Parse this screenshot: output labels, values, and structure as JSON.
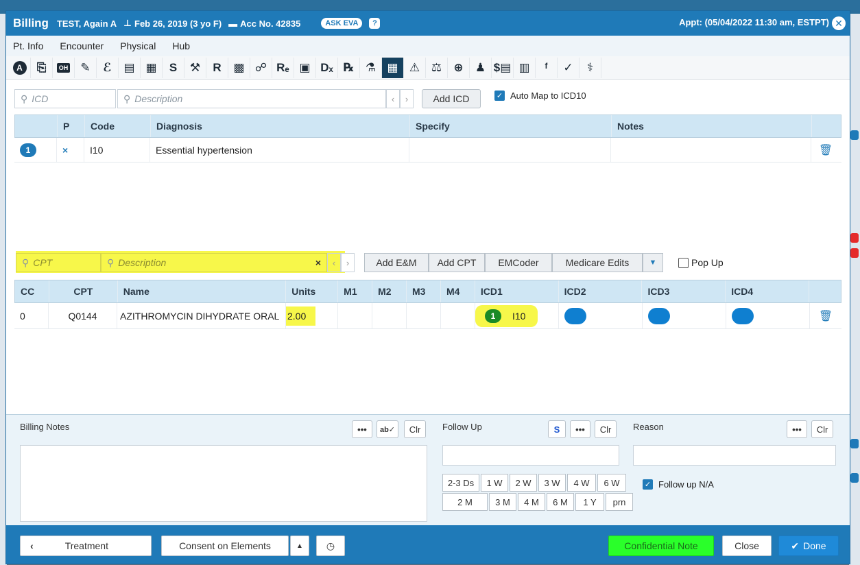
{
  "window": {
    "title": "Billing",
    "patient": "TEST, Again A",
    "dob": "Feb 26, 2019 (3 yo F)",
    "account": "Acc No. 42835",
    "ask_eva": "ASK EVA",
    "help": "?",
    "appointment": "Appt: (05/04/2022 11:30 am, ESTPT)"
  },
  "menu": [
    "Pt. Info",
    "Encounter",
    "Physical",
    "Hub"
  ],
  "toolbar": [
    "A",
    "⎘",
    "OH",
    "✎",
    "ℰ",
    "▤",
    "▦",
    "S",
    "⚒",
    "R",
    "▩",
    "☍",
    "Rₑ",
    "▣",
    "Dₓ",
    "℞",
    "⚗",
    "▦",
    "⚠",
    "⚖",
    "⊕",
    "♟",
    "$▤",
    "▥",
    "ᶠ",
    "✓",
    "⚕"
  ],
  "icd": {
    "icd_placeholder": "ICD",
    "desc_placeholder": "Description",
    "add_label": "Add ICD",
    "auto_map": "Auto Map to ICD10",
    "headers": [
      "",
      "P",
      "Code",
      "Diagnosis",
      "Specify",
      "Notes",
      ""
    ],
    "rows": [
      {
        "num": "1",
        "p": "×",
        "code": "I10",
        "diagnosis": "Essential hypertension",
        "specify": "",
        "notes": ""
      }
    ]
  },
  "cpt": {
    "cpt_placeholder": "CPT",
    "desc_placeholder": "Description",
    "clear": "×",
    "buttons": [
      "Add E&M",
      "Add CPT",
      "EMCoder",
      "Medicare Edits"
    ],
    "popup": "Pop Up",
    "headers": [
      "CC",
      "CPT",
      "Name",
      "Units",
      "M1",
      "M2",
      "M3",
      "M4",
      "ICD1",
      "ICD2",
      "ICD3",
      "ICD4",
      ""
    ],
    "rows": [
      {
        "cc": "0",
        "cpt": "Q0144",
        "name": "AZITHROMYCIN DIHYDRATE ORAL",
        "units": "2.00",
        "icd1_num": "1",
        "icd1_code": "I10"
      }
    ]
  },
  "notes": {
    "billing_label": "Billing Notes",
    "more": "•••",
    "spell": "ab✓",
    "clr": "Clr",
    "followup_label": "Follow Up",
    "s": "S",
    "reason_label": "Reason",
    "followup_na": "Follow up N/A",
    "intervals_row1": [
      "2-3 Ds",
      "1 W",
      "2 W",
      "3 W",
      "4 W",
      "6 W"
    ],
    "intervals_row2": [
      "2 M",
      "3 M",
      "4 M",
      "6 M",
      "1 Y",
      "prn"
    ]
  },
  "footer": {
    "treatment": "Treatment",
    "consent": "Consent on Elements",
    "confidential": "Confidential Note",
    "close": "Close",
    "done": "Done"
  },
  "colors": {
    "primary": "#1f7ab8",
    "highlight": "#f7f74a",
    "confidential": "#2aff2a",
    "header_bg": "#cfe6f4"
  }
}
